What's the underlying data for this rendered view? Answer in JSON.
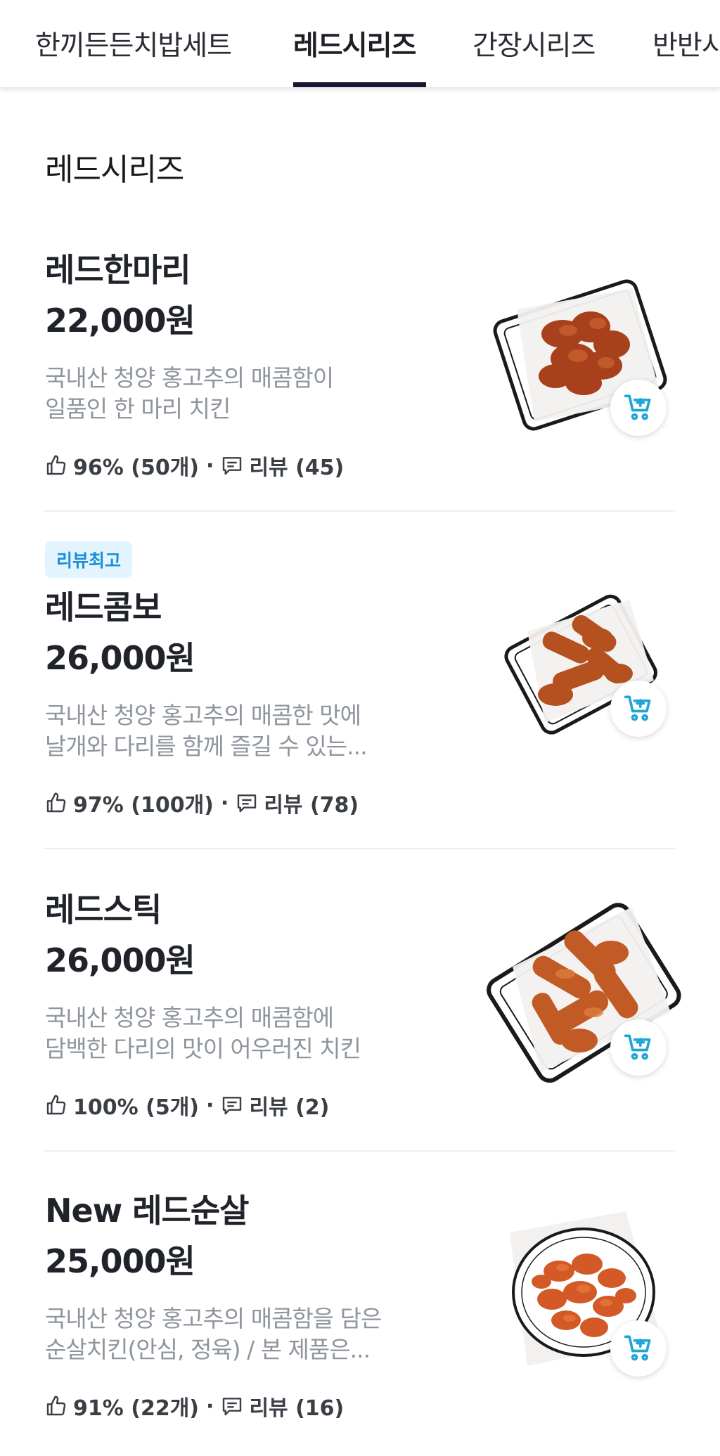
{
  "tabs": [
    {
      "label": "한끼든든치밥세트",
      "active": false
    },
    {
      "label": "레드시리즈",
      "active": true
    },
    {
      "label": "간장시리즈",
      "active": false
    },
    {
      "label": "반반시",
      "active": false
    }
  ],
  "section": {
    "title": "레드시리즈"
  },
  "menu_items": [
    {
      "badge": "",
      "name": "레드한마리",
      "price": "22,000원",
      "desc_line1": "국내산 청양 홍고추의 매콤함이",
      "desc_line2": "일품인 한 마리 치킨",
      "likes": "96% (50개)",
      "reviews": "리뷰 (45)"
    },
    {
      "badge": "리뷰최고",
      "name": "레드콤보",
      "price": "26,000원",
      "desc_line1": "국내산 청양 홍고추의 매콤한 맛에",
      "desc_line2": "날개와 다리를 함께 즐길 수 있는...",
      "likes": "97% (100개)",
      "reviews": "리뷰 (78)"
    },
    {
      "badge": "",
      "name": "레드스틱",
      "price": "26,000원",
      "desc_line1": "국내산 청양 홍고추의 매콤함에",
      "desc_line2": "담백한 다리의 맛이 어우러진 치킨",
      "likes": "100% (5개)",
      "reviews": "리뷰 (2)"
    },
    {
      "badge": "",
      "name": "New 레드순살",
      "price": "25,000원",
      "desc_line1": "국내산 청양 홍고추의 매콤함을 담은",
      "desc_line2": "순살치킨(안심, 정육) / 본 제품은...",
      "likes": "91% (22개)",
      "reviews": "리뷰 (16)"
    }
  ],
  "separator": "·",
  "icons": {
    "like": "thumbs-up-icon",
    "review": "chat-bubble-icon",
    "cart": "add-to-cart-icon"
  },
  "colors": {
    "tab_indicator": "#1c1634",
    "cart_icon": "#1fa5d8",
    "badge_bg": "#e3f4ff",
    "badge_text": "#1a8fd6",
    "desc_text": "#8f959c"
  }
}
